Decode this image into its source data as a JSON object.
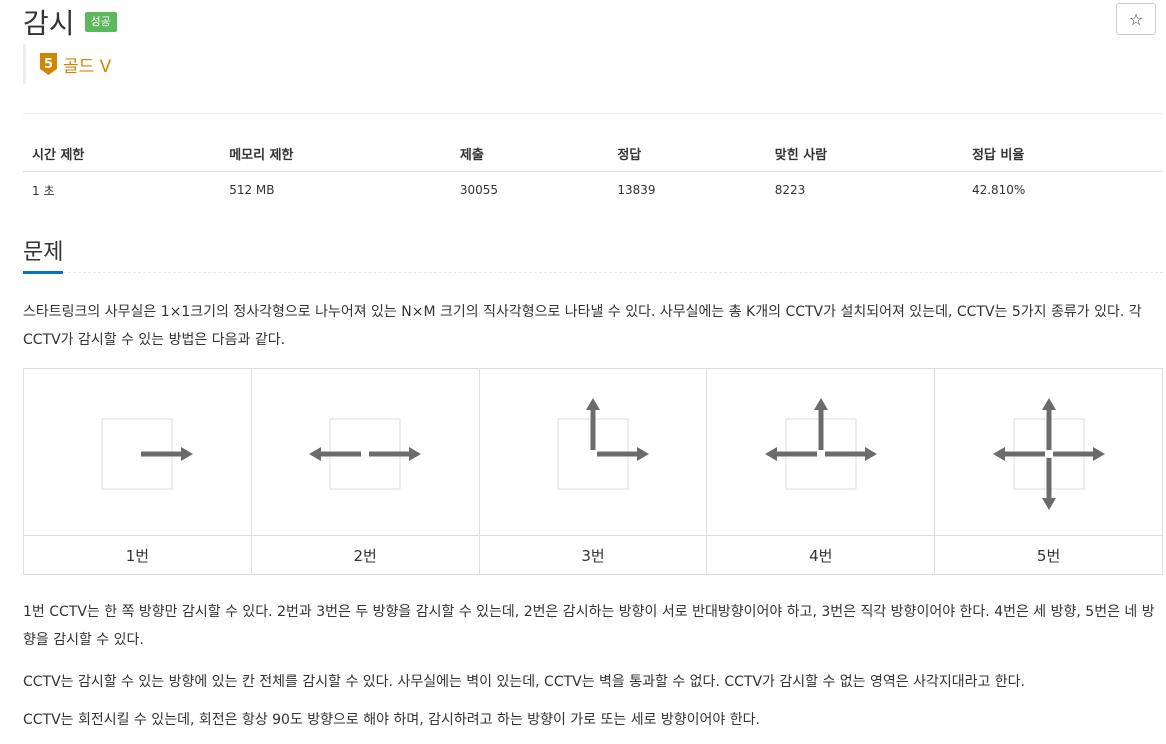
{
  "problem": {
    "title": "감시",
    "status_badge": "성공",
    "tier": {
      "level": "5",
      "name": "골드 V"
    },
    "star": "☆"
  },
  "info_table": {
    "headers": [
      "시간 제한",
      "메모리 제한",
      "제출",
      "정답",
      "맞힌 사람",
      "정답 비율"
    ],
    "values": [
      "1 초",
      "512 MB",
      "30055",
      "13839",
      "8223",
      "42.810%"
    ]
  },
  "section": {
    "heading": "문제"
  },
  "description": {
    "p1": "스타트링크의 사무실은 1×1크기의 정사각형으로 나누어져 있는 N×M 크기의 직사각형으로 나타낼 수 있다. 사무실에는 총 K개의 CCTV가 설치되어져 있는데, CCTV는 5가지 종류가 있다. 각 CCTV가 감시할 수 있는 방법은 다음과 같다.",
    "p2": "1번 CCTV는 한 쪽 방향만 감시할 수 있다. 2번과 3번은 두 방향을 감시할 수 있는데, 2번은 감시하는 방향이 서로 반대방향이어야 하고, 3번은 직각 방향이어야 한다. 4번은 세 방향, 5번은 네 방향을 감시할 수 있다.",
    "p3": "CCTV는 감시할 수 있는 방향에 있는 칸 전체를 감시할 수 있다. 사무실에는 벽이 있는데, CCTV는 벽을 통과할 수 없다. CCTV가 감시할 수 없는 영역은 사각지대라고 한다.",
    "p4": "CCTV는 회전시킬 수 있는데, 회전은 항상 90도 방향으로 해야 하며, 감시하려고 하는 방향이 가로 또는 세로 방향이어야 한다."
  },
  "cctv_types": [
    {
      "label": "1번",
      "directions": [
        "right"
      ]
    },
    {
      "label": "2번",
      "directions": [
        "left",
        "right"
      ]
    },
    {
      "label": "3번",
      "directions": [
        "up",
        "right"
      ]
    },
    {
      "label": "4번",
      "directions": [
        "left",
        "up",
        "right"
      ]
    },
    {
      "label": "5번",
      "directions": [
        "left",
        "up",
        "right",
        "down"
      ]
    }
  ],
  "colors": {
    "success": "#5cb85c",
    "gold": "#d28500",
    "accent": "#0076c0",
    "arrow": "#6b6b6b"
  }
}
